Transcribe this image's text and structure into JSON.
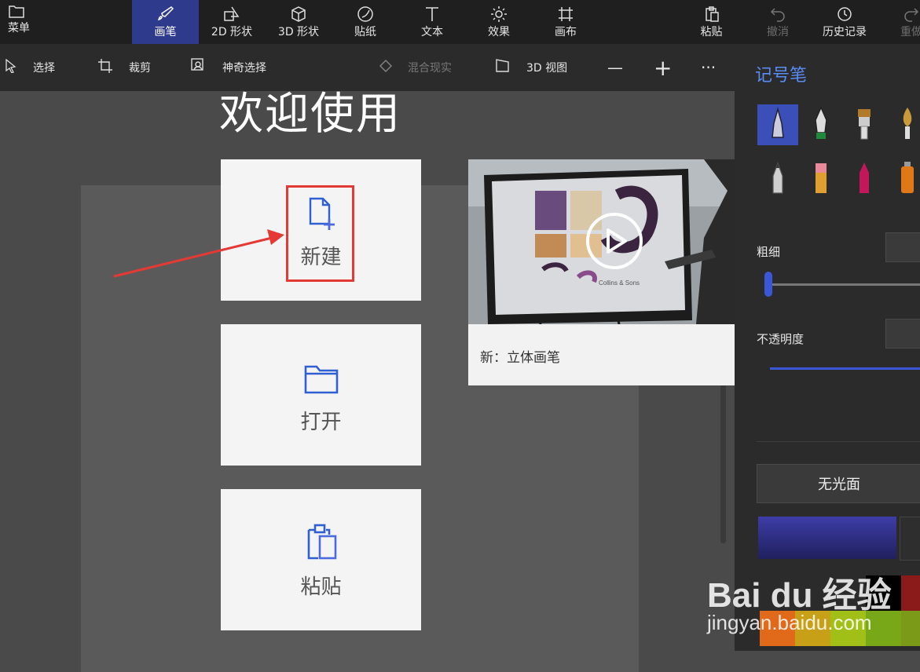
{
  "topbar": {
    "items": [
      {
        "label": "菜单",
        "icon": "folder-icon"
      },
      {
        "label": "画笔",
        "icon": "brush-icon",
        "active": true
      },
      {
        "label": "2D 形状",
        "icon": "shapes-2d-icon"
      },
      {
        "label": "3D 形状",
        "icon": "cube-icon"
      },
      {
        "label": "贴纸",
        "icon": "sticker-icon"
      },
      {
        "label": "文本",
        "icon": "text-icon"
      },
      {
        "label": "效果",
        "icon": "sun-icon"
      },
      {
        "label": "画布",
        "icon": "canvas-icon"
      },
      {
        "label": "粘贴",
        "icon": "paste-icon"
      },
      {
        "label": "撤消",
        "icon": "undo-icon",
        "disabled": true
      },
      {
        "label": "历史记录",
        "icon": "history-icon"
      },
      {
        "label": "重做",
        "icon": "redo-icon",
        "disabled": true
      }
    ]
  },
  "subbar": {
    "select": "选择",
    "crop": "裁剪",
    "magic_select": "神奇选择",
    "mixed_reality": "混合现实",
    "view_3d": "3D 视图",
    "zoom_out": "—",
    "zoom_in": "+",
    "more": "···"
  },
  "welcome": {
    "title": "欢迎使用",
    "tiles": [
      {
        "label": "新建",
        "icon": "new-file-icon"
      },
      {
        "label": "打开",
        "icon": "folder-open-icon"
      },
      {
        "label": "粘贴",
        "icon": "clipboard-paste-icon"
      }
    ],
    "video": {
      "caption": "新：立体画笔",
      "icon": "play-icon",
      "thumb_text": "Collins & Sons"
    }
  },
  "panel": {
    "title": "记号笔",
    "brushes": [
      "marker-icon",
      "calligraphy-pen-icon",
      "oil-brush-icon",
      "watercolor-icon",
      "pencil-icon",
      "eraser-icon",
      "crayon-icon",
      "spray-can-icon"
    ],
    "thickness_label": "粗细",
    "opacity_label": "不透明度",
    "finish_label": "无光面",
    "opacity_level": 1.0,
    "thickness_level": 0.04
  },
  "colors": {
    "accent": "#3b57d8",
    "highlight": "#e53935",
    "swatches": [
      "#e06a1a",
      "#c8a018",
      "#a0c018",
      "#78a818",
      "#000000",
      "#8b1a1a"
    ]
  },
  "watermark": {
    "logo": "Bai du 经验",
    "url": "jingyan.baidu.com"
  }
}
